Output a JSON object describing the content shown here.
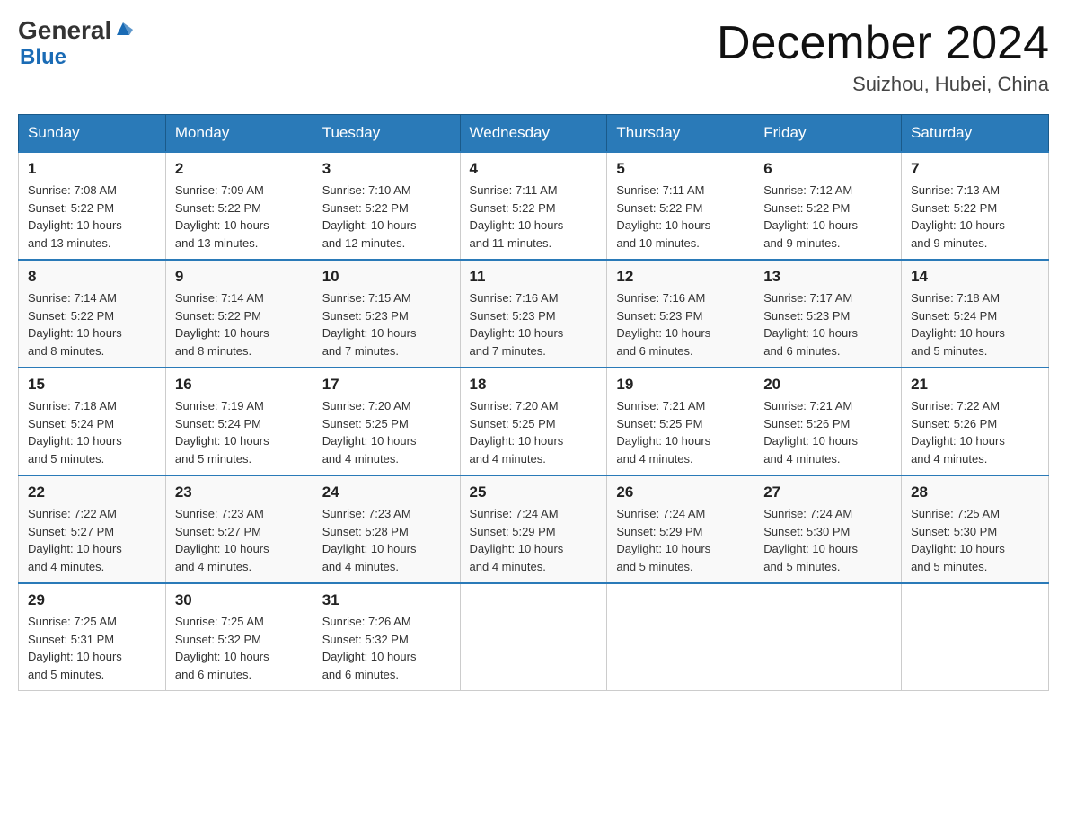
{
  "header": {
    "logo": {
      "general": "General",
      "blue": "Blue"
    },
    "title": "December 2024",
    "location": "Suizhou, Hubei, China"
  },
  "weekdays": [
    "Sunday",
    "Monday",
    "Tuesday",
    "Wednesday",
    "Thursday",
    "Friday",
    "Saturday"
  ],
  "weeks": [
    [
      {
        "day": "1",
        "sunrise": "7:08 AM",
        "sunset": "5:22 PM",
        "daylight": "10 hours and 13 minutes."
      },
      {
        "day": "2",
        "sunrise": "7:09 AM",
        "sunset": "5:22 PM",
        "daylight": "10 hours and 13 minutes."
      },
      {
        "day": "3",
        "sunrise": "7:10 AM",
        "sunset": "5:22 PM",
        "daylight": "10 hours and 12 minutes."
      },
      {
        "day": "4",
        "sunrise": "7:11 AM",
        "sunset": "5:22 PM",
        "daylight": "10 hours and 11 minutes."
      },
      {
        "day": "5",
        "sunrise": "7:11 AM",
        "sunset": "5:22 PM",
        "daylight": "10 hours and 10 minutes."
      },
      {
        "day": "6",
        "sunrise": "7:12 AM",
        "sunset": "5:22 PM",
        "daylight": "10 hours and 9 minutes."
      },
      {
        "day": "7",
        "sunrise": "7:13 AM",
        "sunset": "5:22 PM",
        "daylight": "10 hours and 9 minutes."
      }
    ],
    [
      {
        "day": "8",
        "sunrise": "7:14 AM",
        "sunset": "5:22 PM",
        "daylight": "10 hours and 8 minutes."
      },
      {
        "day": "9",
        "sunrise": "7:14 AM",
        "sunset": "5:22 PM",
        "daylight": "10 hours and 8 minutes."
      },
      {
        "day": "10",
        "sunrise": "7:15 AM",
        "sunset": "5:23 PM",
        "daylight": "10 hours and 7 minutes."
      },
      {
        "day": "11",
        "sunrise": "7:16 AM",
        "sunset": "5:23 PM",
        "daylight": "10 hours and 7 minutes."
      },
      {
        "day": "12",
        "sunrise": "7:16 AM",
        "sunset": "5:23 PM",
        "daylight": "10 hours and 6 minutes."
      },
      {
        "day": "13",
        "sunrise": "7:17 AM",
        "sunset": "5:23 PM",
        "daylight": "10 hours and 6 minutes."
      },
      {
        "day": "14",
        "sunrise": "7:18 AM",
        "sunset": "5:24 PM",
        "daylight": "10 hours and 5 minutes."
      }
    ],
    [
      {
        "day": "15",
        "sunrise": "7:18 AM",
        "sunset": "5:24 PM",
        "daylight": "10 hours and 5 minutes."
      },
      {
        "day": "16",
        "sunrise": "7:19 AM",
        "sunset": "5:24 PM",
        "daylight": "10 hours and 5 minutes."
      },
      {
        "day": "17",
        "sunrise": "7:20 AM",
        "sunset": "5:25 PM",
        "daylight": "10 hours and 4 minutes."
      },
      {
        "day": "18",
        "sunrise": "7:20 AM",
        "sunset": "5:25 PM",
        "daylight": "10 hours and 4 minutes."
      },
      {
        "day": "19",
        "sunrise": "7:21 AM",
        "sunset": "5:25 PM",
        "daylight": "10 hours and 4 minutes."
      },
      {
        "day": "20",
        "sunrise": "7:21 AM",
        "sunset": "5:26 PM",
        "daylight": "10 hours and 4 minutes."
      },
      {
        "day": "21",
        "sunrise": "7:22 AM",
        "sunset": "5:26 PM",
        "daylight": "10 hours and 4 minutes."
      }
    ],
    [
      {
        "day": "22",
        "sunrise": "7:22 AM",
        "sunset": "5:27 PM",
        "daylight": "10 hours and 4 minutes."
      },
      {
        "day": "23",
        "sunrise": "7:23 AM",
        "sunset": "5:27 PM",
        "daylight": "10 hours and 4 minutes."
      },
      {
        "day": "24",
        "sunrise": "7:23 AM",
        "sunset": "5:28 PM",
        "daylight": "10 hours and 4 minutes."
      },
      {
        "day": "25",
        "sunrise": "7:24 AM",
        "sunset": "5:29 PM",
        "daylight": "10 hours and 4 minutes."
      },
      {
        "day": "26",
        "sunrise": "7:24 AM",
        "sunset": "5:29 PM",
        "daylight": "10 hours and 5 minutes."
      },
      {
        "day": "27",
        "sunrise": "7:24 AM",
        "sunset": "5:30 PM",
        "daylight": "10 hours and 5 minutes."
      },
      {
        "day": "28",
        "sunrise": "7:25 AM",
        "sunset": "5:30 PM",
        "daylight": "10 hours and 5 minutes."
      }
    ],
    [
      {
        "day": "29",
        "sunrise": "7:25 AM",
        "sunset": "5:31 PM",
        "daylight": "10 hours and 5 minutes."
      },
      {
        "day": "30",
        "sunrise": "7:25 AM",
        "sunset": "5:32 PM",
        "daylight": "10 hours and 6 minutes."
      },
      {
        "day": "31",
        "sunrise": "7:26 AM",
        "sunset": "5:32 PM",
        "daylight": "10 hours and 6 minutes."
      },
      null,
      null,
      null,
      null
    ]
  ],
  "labels": {
    "sunrise": "Sunrise:",
    "sunset": "Sunset:",
    "daylight": "Daylight:"
  }
}
